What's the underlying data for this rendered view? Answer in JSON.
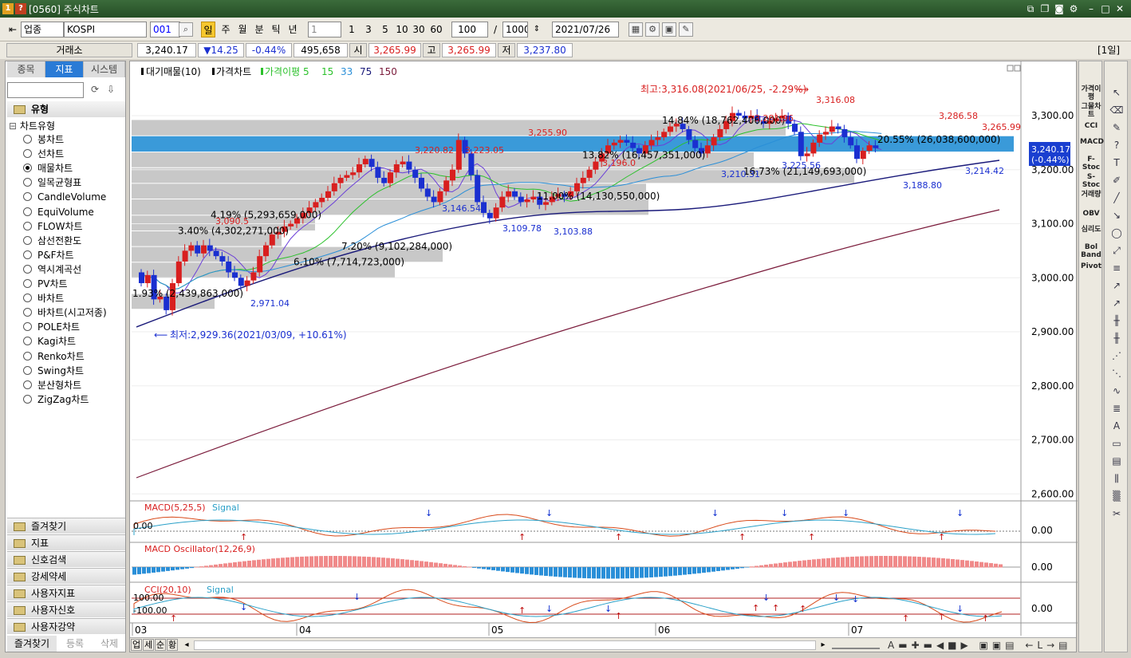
{
  "window": {
    "title": "[0560] 주식차트",
    "badges": [
      "1",
      "?"
    ]
  },
  "toolbar": {
    "market": "업종",
    "index": "KOSPI",
    "code": "001",
    "periods": [
      "일",
      "주",
      "월",
      "분",
      "틱",
      "년"
    ],
    "active_period": "일",
    "interval_select": "1",
    "intervals": [
      "1",
      "3",
      "5",
      "10",
      "30",
      "60"
    ],
    "count": "100",
    "slash": "/",
    "total": "1000",
    "date": "2021/07/26",
    "right_label": "[1일]"
  },
  "quote": {
    "exchange": "거래소",
    "price": "3,240.17",
    "change": "▼14.25",
    "pct": "-0.44%",
    "volume": "495,658",
    "open_label": "시",
    "open": "3,265.99",
    "high_label": "고",
    "high": "3,265.99",
    "low_label": "저",
    "low": "3,237.80"
  },
  "left_panel": {
    "tabs": [
      "종목",
      "지표",
      "시스템"
    ],
    "active_tab": "지표",
    "section": "유형",
    "tree_root": "차트유형",
    "chart_types": [
      "봉차트",
      "선차트",
      "매물차트",
      "일목균형표",
      "CandleVolume",
      "EquiVolume",
      "FLOW차트",
      "삼선전환도",
      "P&F차트",
      "역시계곡선",
      "PV차트",
      "바차트",
      "바차트(시고저종)",
      "POLE차트",
      "Kagi차트",
      "Renko차트",
      "Swing차트",
      "분산형차트",
      "ZigZag차트"
    ],
    "selected_type": "매물차트",
    "folders": [
      "즐겨찾기",
      "지표",
      "신호검색",
      "강세약세",
      "사용자지표",
      "사용자신호",
      "사용자강약"
    ],
    "bottom_tabs": [
      "즐겨찾기",
      "등록",
      "삭제"
    ]
  },
  "price_panel": {
    "legend": [
      "대기매물(10)",
      "가격차트",
      "가격이평 5",
      "15",
      "33",
      "75",
      "150"
    ],
    "high_annotation": "최고:3,316.08(2021/06/25, -2.29%)",
    "low_annotation": "최저:2,929.36(2021/03/09, +10.61%)",
    "last_price": "3,240.17",
    "last_pct": "(-0.44%)",
    "y_labels": [
      "3,300.00",
      "3,200.00",
      "3,100.00",
      "3,000.00",
      "2,900.00",
      "2,800.00",
      "2,700.00",
      "2,600.00"
    ],
    "x_labels": [
      "03",
      "04",
      "05",
      "06",
      "07"
    ],
    "volume_profile": [
      {
        "label": "14.84% (18,762,406,000)",
        "pct": 14.84
      },
      {
        "label": "20.55% (26,038,600,000)",
        "pct": 20.55
      },
      {
        "label": "13.82% (16,457,351,000)",
        "pct": 13.82
      },
      {
        "label": "16.73% (21,149,693,000)",
        "pct": 16.73
      },
      {
        "label": "11.00% (14,130,550,000)",
        "pct": 11.0
      },
      {
        "label": "4.19% (5,293,659,000)",
        "pct": 4.19
      },
      {
        "label": "3.40% (4,302,271,000)",
        "pct": 3.4
      },
      {
        "label": "7.20% (9,102,284,000)",
        "pct": 7.2
      },
      {
        "label": "6.10% (7,714,723,000)",
        "pct": 6.1
      },
      {
        "label": "1.93% (2,439,863,000)",
        "pct": 1.93
      }
    ],
    "price_labels_red": [
      "3,316.08",
      "3,286.58",
      "3,281.96",
      "3,265.99",
      "3,255.90",
      "3,220.82",
      "3,223.05"
    ],
    "price_labels_blue": [
      "3,225.56",
      "3,210.31",
      "3,214.42",
      "3,188.80",
      "3,146.54",
      "3,109.78",
      "3,103.88",
      "2,971.04"
    ],
    "partial_labels": [
      "3,090.5",
      "3,196.0"
    ]
  },
  "macd_panel": {
    "legend": [
      "MACD(5,25,5)",
      "Signal"
    ],
    "left_value": "0.00",
    "right_value": "0.00"
  },
  "osc_panel": {
    "legend": [
      "MACD Oscillator(12,26,9)"
    ],
    "right_value": "0.00"
  },
  "cci_panel": {
    "legend": [
      "CCI(20,10)",
      "Signal"
    ],
    "upper": "100.00",
    "lower": "-100.00",
    "right_value": "0.00"
  },
  "bottom_bar": {
    "buttons": [
      "업",
      "세",
      "순",
      "황"
    ]
  },
  "right_toolbar": {
    "labels": [
      "가격이평",
      "그물차트",
      "CCI",
      "MACD",
      "F-Stoc",
      "S-Stoc",
      "거래량",
      "OBV",
      "심리도",
      "Bol Band",
      "Pivot"
    ]
  },
  "colors": {
    "up": "#d81f1f",
    "down": "#1a2fd0",
    "band": "#c8c8c8",
    "band_current": "#3a9ad9",
    "ma5": "#6b3fd8",
    "ma15": "#2cc12c",
    "ma33": "#2a8fd8",
    "ma75": "#1a1a7a",
    "ma150": "#7a1a3a"
  },
  "chart_data": {
    "type": "candlestick",
    "x": [
      "2021-03",
      "2021-04",
      "2021-05",
      "2021-06",
      "2021-07"
    ],
    "ylim": [
      2560,
      3330
    ],
    "key_levels": {
      "high": 3316.08,
      "low": 2929.36,
      "last": 3240.17
    },
    "macd_ylim": [
      -1,
      1
    ],
    "osc_ylim": [
      -1,
      1
    ],
    "cci_ylim": [
      -150,
      150
    ]
  }
}
